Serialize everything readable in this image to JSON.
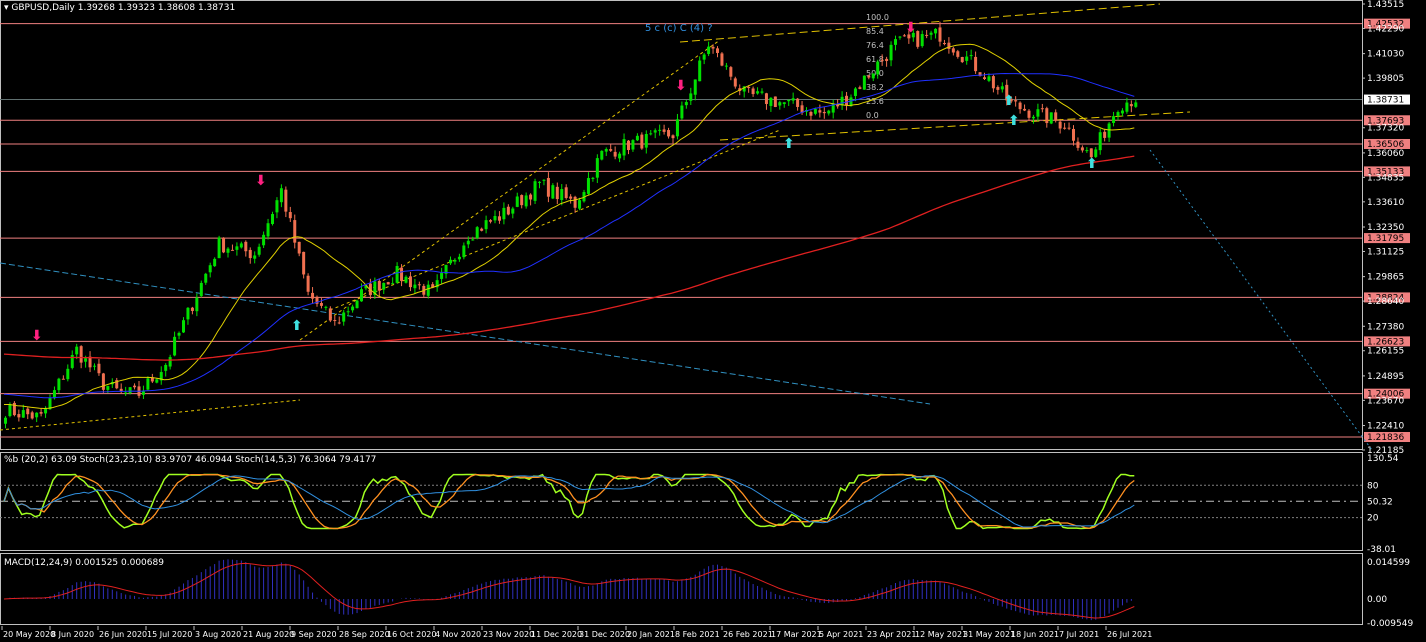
{
  "header": {
    "symbol": "GBPUSD,Daily",
    "ohlc": "1.39268 1.39323 1.38608 1.38731"
  },
  "stoch_header": "%b (20,2) 63.09  Stoch(23,23,10) 83.9707 46.0944  Stoch(14,5,3) 76.3064 79.4177",
  "macd_header": "MACD(12,24,9) 0.001525 0.000689",
  "price_axis": [
    "1.43515",
    "1.42290",
    "1.41030",
    "1.39805",
    "1.37320",
    "1.36060",
    "1.34835",
    "1.33610",
    "1.32350",
    "1.31125",
    "1.29865",
    "1.28640",
    "1.27380",
    "1.26155",
    "1.24895",
    "1.23670",
    "1.22410",
    "1.21185"
  ],
  "levels": [
    {
      "value": "1.42532",
      "num": 1.42532
    },
    {
      "value": "1.37693",
      "num": 1.37693
    },
    {
      "value": "1.36506",
      "num": 1.36506
    },
    {
      "value": "1.35133",
      "num": 1.35133
    },
    {
      "value": "1.31795",
      "num": 1.31795
    },
    {
      "value": "1.28824",
      "num": 1.28824
    },
    {
      "value": "1.26623",
      "num": 1.26623
    },
    {
      "value": "1.24006",
      "num": 1.24006
    },
    {
      "value": "1.21836",
      "num": 1.21836
    }
  ],
  "current_price": "1.38731",
  "stoch_axis": {
    "max": "130.54",
    "upper": "80",
    "mid": "50.32",
    "lower": "20",
    "min": "-38.01"
  },
  "macd_axis": {
    "max": "0.014599",
    "zero": "0.00",
    "min": "-0.009549"
  },
  "wave_labels": "5 c (c) C (4) ?",
  "fib_labels": [
    "100.0",
    "85.4",
    "76.4",
    "61.8",
    "50.0",
    "38.2",
    "23.6",
    "0.0"
  ],
  "dates": [
    "20 May 2020",
    "8 Jun 2020",
    "26 Jun 2020",
    "15 Jul 2020",
    "3 Aug 2020",
    "21 Aug 2020",
    "9 Sep 2020",
    "28 Sep 2020",
    "16 Oct 2020",
    "4 Nov 2020",
    "23 Nov 2020",
    "11 Dec 2020",
    "31 Dec 2020",
    "20 Jan 2021",
    "8 Feb 2021",
    "26 Feb 2021",
    "17 Mar 2021",
    "5 Apr 2021",
    "23 Apr 2021",
    "12 May 2021",
    "31 May 2021",
    "18 Jun 2021",
    "7 Jul 2021",
    "26 Jul 2021"
  ],
  "colors": {
    "up": "#00e000",
    "down": "#f07050",
    "level": "#f08080",
    "sma_fast": "#e0d000",
    "sma_mid": "#2030ff",
    "sma_slow": "#e02020",
    "stoch_k": "#a0ff20",
    "stoch_d": "#ff9020",
    "stoch_slow": "#3090e0",
    "macd_hist": "#3030c0",
    "macd_signal": "#e02020"
  },
  "chart_data": {
    "type": "candlestick",
    "title": "GBPUSD,Daily",
    "ylim": [
      1.21185,
      1.43515
    ],
    "anchors": [
      [
        0,
        1.232
      ],
      [
        8,
        1.228
      ],
      [
        16,
        1.262
      ],
      [
        22,
        1.245
      ],
      [
        26,
        1.24
      ],
      [
        30,
        1.24
      ],
      [
        36,
        1.255
      ],
      [
        48,
        1.315
      ],
      [
        56,
        1.31
      ],
      [
        62,
        1.342
      ],
      [
        68,
        1.29
      ],
      [
        74,
        1.275
      ],
      [
        80,
        1.29
      ],
      [
        88,
        1.3
      ],
      [
        96,
        1.29
      ],
      [
        104,
        1.32
      ],
      [
        112,
        1.33
      ],
      [
        120,
        1.345
      ],
      [
        128,
        1.335
      ],
      [
        134,
        1.36
      ],
      [
        140,
        1.365
      ],
      [
        150,
        1.37
      ],
      [
        158,
        1.415
      ],
      [
        166,
        1.39
      ],
      [
        176,
        1.385
      ],
      [
        184,
        1.38
      ],
      [
        190,
        1.39
      ],
      [
        200,
        1.415
      ],
      [
        210,
        1.42
      ],
      [
        220,
        1.4
      ],
      [
        226,
        1.385
      ],
      [
        232,
        1.38
      ],
      [
        238,
        1.375
      ],
      [
        244,
        1.358
      ],
      [
        250,
        1.385
      ],
      [
        254,
        1.388
      ]
    ]
  }
}
